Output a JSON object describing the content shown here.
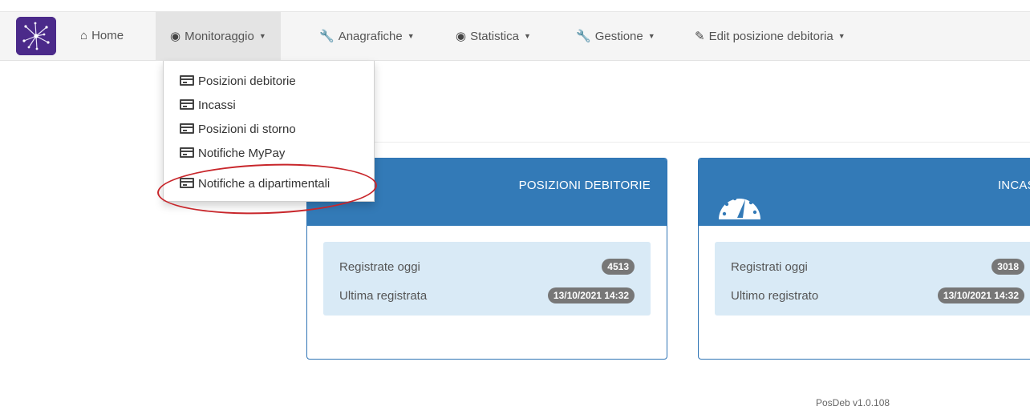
{
  "navbar": {
    "items": [
      {
        "label": "Home",
        "icon": "home-icon",
        "caret": false,
        "active": false
      },
      {
        "label": "Monitoraggio",
        "icon": "dashboard-icon",
        "caret": true,
        "active": true
      },
      {
        "label": "Anagrafiche",
        "icon": "wrench-icon",
        "caret": true,
        "active": false
      },
      {
        "label": "Statistica",
        "icon": "dashboard-icon",
        "caret": true,
        "active": false
      },
      {
        "label": "Gestione",
        "icon": "wrench-icon",
        "caret": true,
        "active": false
      },
      {
        "label": "Edit posizione debitoria",
        "icon": "edit-icon",
        "caret": true,
        "active": false
      }
    ]
  },
  "dropdown": {
    "items": [
      {
        "label": "Posizioni debitorie",
        "icon": "credit-card-icon"
      },
      {
        "label": "Incassi",
        "icon": "credit-card-icon"
      },
      {
        "label": "Posizioni di storno",
        "icon": "credit-card-icon"
      },
      {
        "label": "Notifiche MyPay",
        "icon": "credit-card-icon"
      },
      {
        "label": "Notifiche a dipartimentali",
        "icon": "credit-card-icon",
        "highlighted": true
      }
    ]
  },
  "panels": [
    {
      "title": "POSIZIONI DEBITORIE",
      "rows": [
        {
          "label": "Registrate oggi",
          "value": "4513"
        },
        {
          "label": "Ultima registrata",
          "value": "13/10/2021 14:32"
        }
      ]
    },
    {
      "title": "INCASS",
      "icon": "dashboard-icon",
      "rows": [
        {
          "label": "Registrati oggi",
          "value": "3018"
        },
        {
          "label": "Ultimo registrato",
          "value": "13/10/2021 14:32"
        }
      ]
    }
  ],
  "footer": {
    "version": "PosDeb v1.0.108"
  },
  "colors": {
    "primary": "#337ab7",
    "brand": "#4b2a8a",
    "highlight": "#c8262b",
    "badge": "#777777",
    "panel_body": "#d9eaf6"
  }
}
